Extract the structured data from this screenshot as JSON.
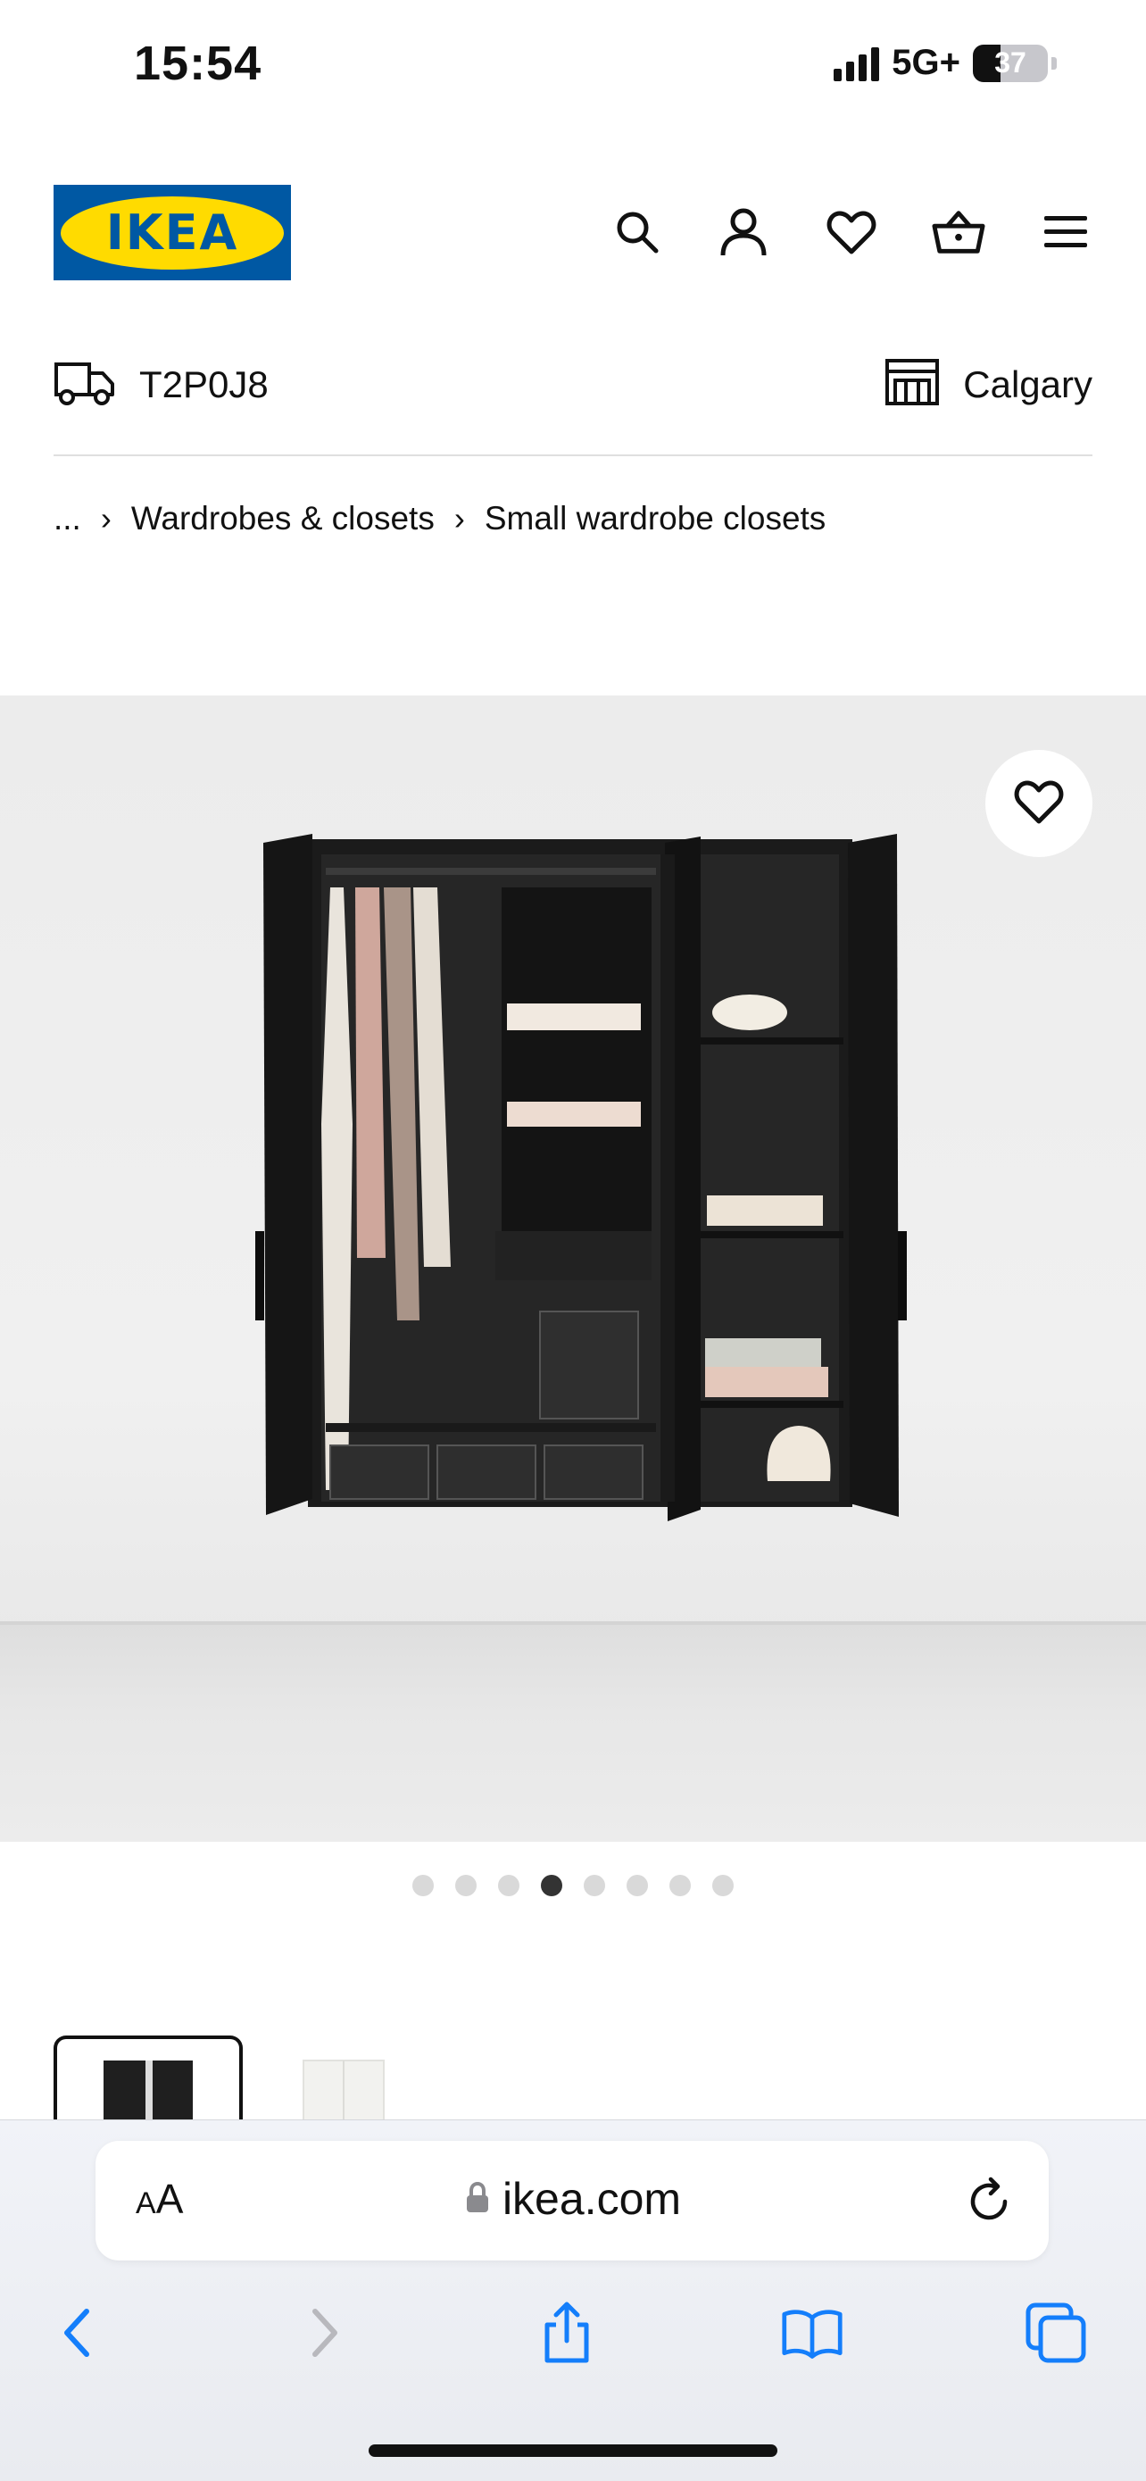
{
  "status_bar": {
    "time": "15:54",
    "network": "5G+",
    "battery": "37",
    "battery_level": 0.37
  },
  "header": {
    "logo_text": "IKEA",
    "brand_colors": {
      "blue": "#0058A3",
      "yellow": "#FFDB00"
    }
  },
  "location": {
    "postal_code": "T2P0J8",
    "store": "Calgary"
  },
  "breadcrumb": {
    "ellipsis": "...",
    "items": [
      "Wardrobes & closets",
      "Small wardrobe closets"
    ]
  },
  "carousel": {
    "total": 8,
    "active_index": 3
  },
  "safari": {
    "text_size_label_small": "A",
    "text_size_label_large": "A",
    "url": "ikea.com"
  }
}
